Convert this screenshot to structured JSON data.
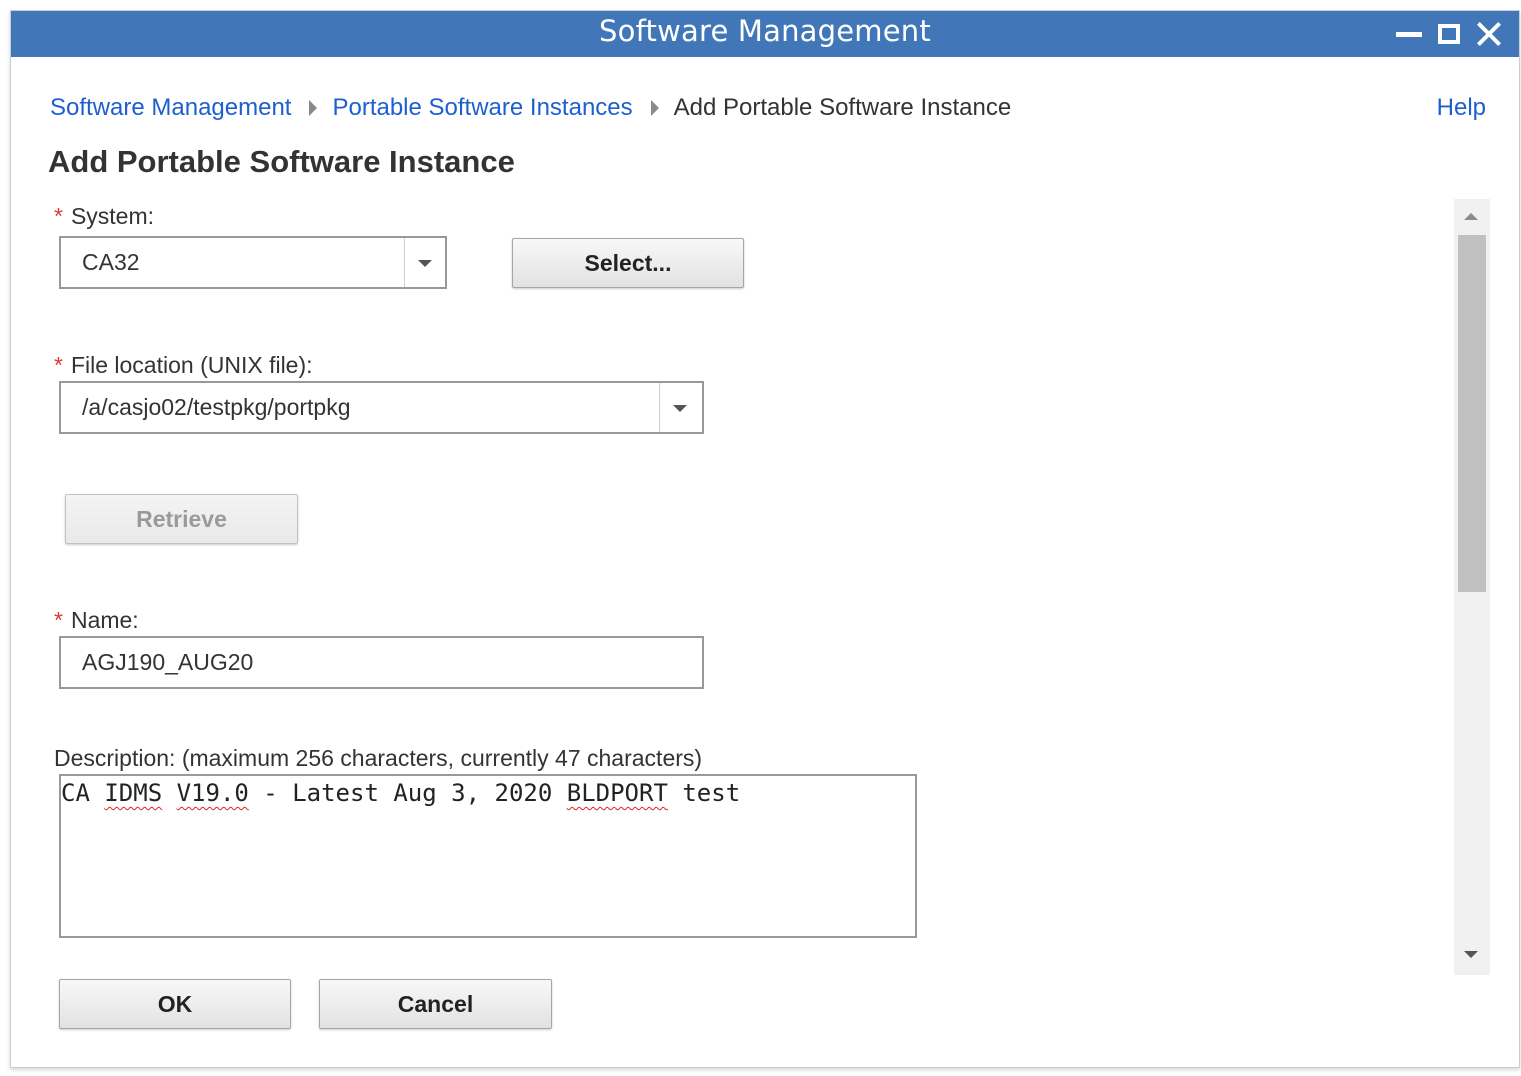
{
  "window": {
    "title": "Software Management",
    "colors": {
      "titlebar": "#4177b8",
      "link": "#1e5fd0",
      "required": "#d93a3a"
    }
  },
  "breadcrumb": {
    "items": [
      {
        "label": "Software Management",
        "link": true
      },
      {
        "label": "Portable Software Instances",
        "link": true
      },
      {
        "label": "Add Portable Software Instance",
        "link": false
      }
    ],
    "separator_icon": "chevron-right-icon"
  },
  "help": {
    "label": "Help"
  },
  "page": {
    "title": "Add Portable Software Instance"
  },
  "form": {
    "required_marker": "*",
    "system": {
      "label": "System:",
      "value": "CA32",
      "select_button": "Select..."
    },
    "file_location": {
      "label": "File location (UNIX file):",
      "value": "/a/casjo02/testpkg/portpkg",
      "retrieve_button": "Retrieve"
    },
    "name": {
      "label": "Name:",
      "value": "AGJ190_AUG20"
    },
    "description": {
      "label": "Description: (maximum 256 characters, currently 47 characters)",
      "segments": [
        "CA ",
        "IDMS",
        " ",
        "V19.0",
        " - Latest Aug 3, 2020 ",
        "BLDPORT",
        " test"
      ]
    }
  },
  "actions": {
    "ok": "OK",
    "cancel": "Cancel"
  }
}
